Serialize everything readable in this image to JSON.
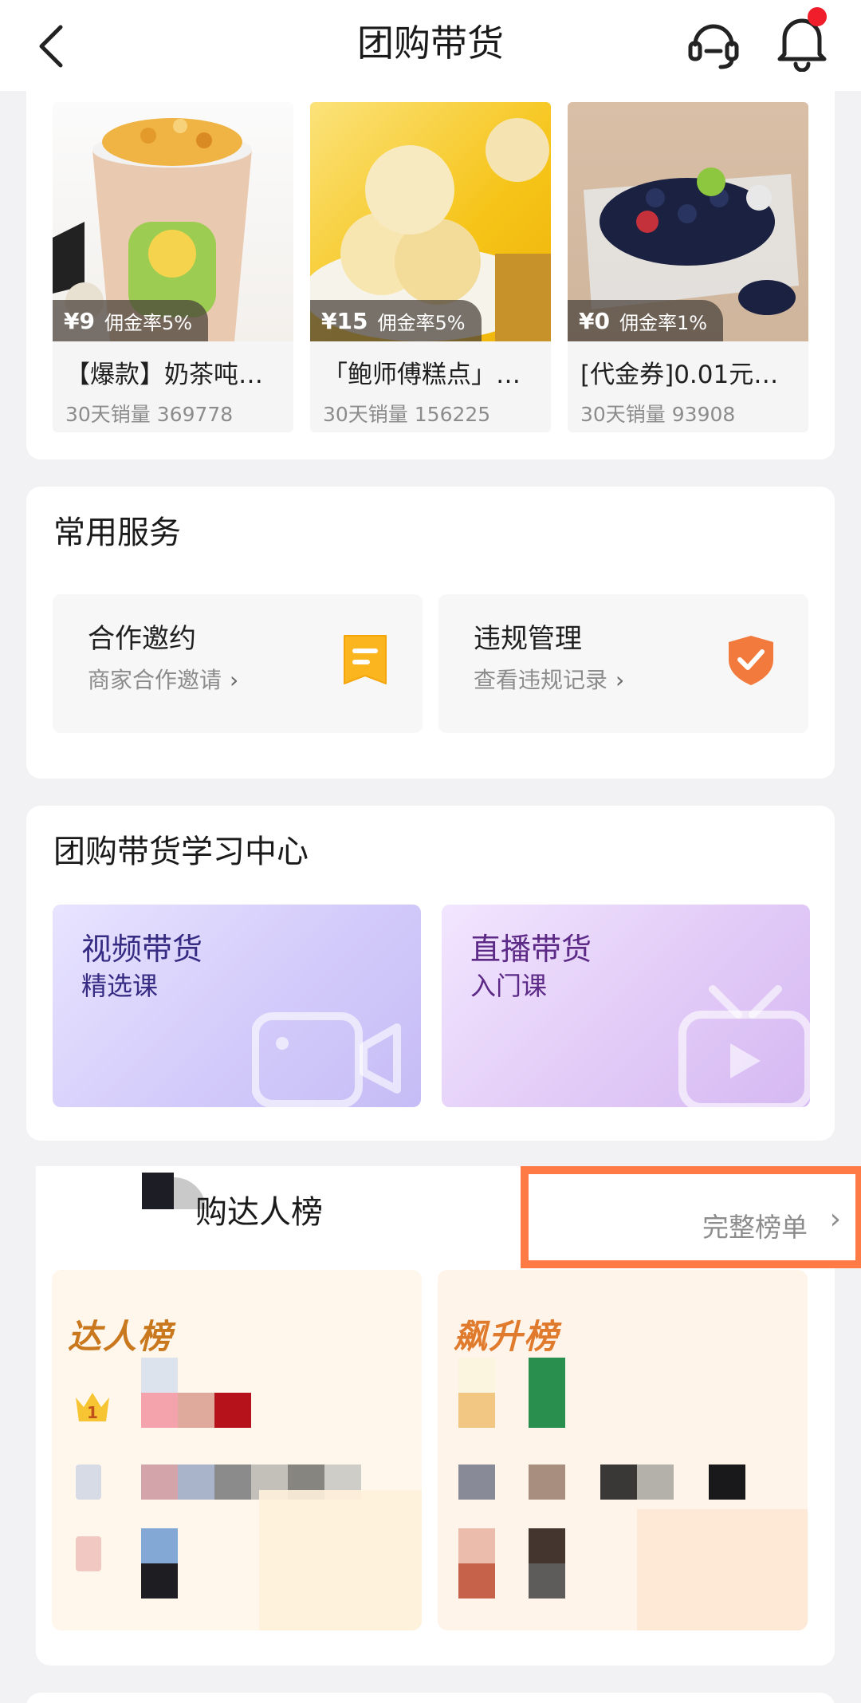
{
  "header": {
    "title": "团购带货"
  },
  "products": [
    {
      "price": "¥9",
      "rate": "佣金率5%",
      "name": "【爆款】奶茶吨…",
      "sales": "30天销量 369778"
    },
    {
      "price": "¥15",
      "rate": "佣金率5%",
      "name": "「鲍师傅糕点」…",
      "sales": "30天销量 156225"
    },
    {
      "price": "¥0",
      "rate": "佣金率1%",
      "name": "[代金券]0.01元…",
      "sales": "30天销量 93908"
    }
  ],
  "services": {
    "title": "常用服务",
    "items": [
      {
        "title": "合作邀约",
        "subtitle": "商家合作邀请",
        "icon": "document-icon"
      },
      {
        "title": "违规管理",
        "subtitle": "查看违规记录",
        "icon": "shield-check-icon"
      }
    ]
  },
  "learning": {
    "title": "团购带货学习中心",
    "items": [
      {
        "title": "视频带货",
        "subtitle": "精选课",
        "icon": "video-camera-icon"
      },
      {
        "title": "直播带货",
        "subtitle": "入门课",
        "icon": "tv-play-icon"
      }
    ]
  },
  "ranking": {
    "title": "购达人榜",
    "full_list": "完整榜单",
    "panels": [
      {
        "title": "达人榜",
        "color": "#c9781e"
      },
      {
        "title": "飙升榜",
        "color": "#e07a2c"
      }
    ]
  }
}
